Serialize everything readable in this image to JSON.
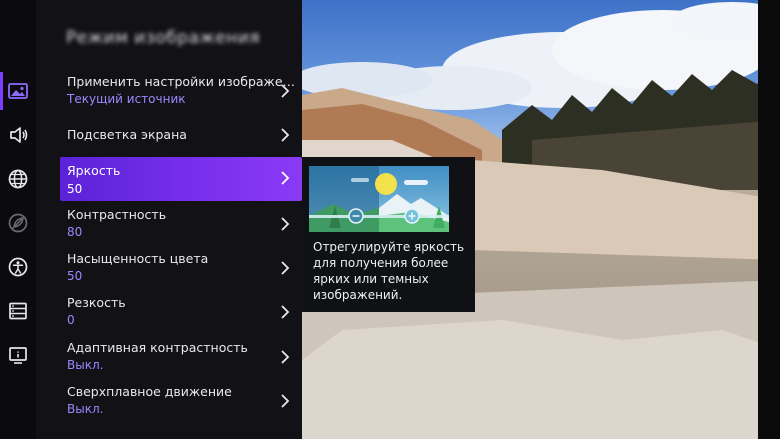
{
  "panel": {
    "title": "Режим изображения"
  },
  "rail": {
    "icons": [
      "picture-icon",
      "sound-icon",
      "network-icon",
      "eco-icon",
      "accessibility-icon",
      "system-icon",
      "info-icon"
    ],
    "active": "picture-icon",
    "accent_color": "#7a3cff"
  },
  "menu": {
    "items": [
      {
        "label": "Применить настройки изображе…",
        "value": "Текущий источник"
      },
      {
        "label": "Подсветка экрана",
        "value": ""
      },
      {
        "label": "Яркость",
        "value": "50"
      },
      {
        "label": "Контрастность",
        "value": "80"
      },
      {
        "label": "Насыщенность цвета",
        "value": "50"
      },
      {
        "label": "Резкость",
        "value": "0"
      },
      {
        "label": "Адаптивная контрастность",
        "value": "Выкл."
      },
      {
        "label": "Сверхплавное движение",
        "value": "Выкл."
      }
    ],
    "selected_index": 2,
    "selected_color": "#6a2ae4"
  },
  "info_card": {
    "icon": "brightness-illustration",
    "text": "Отрегулируйте яркость для получения более ярких или темных изображений."
  }
}
